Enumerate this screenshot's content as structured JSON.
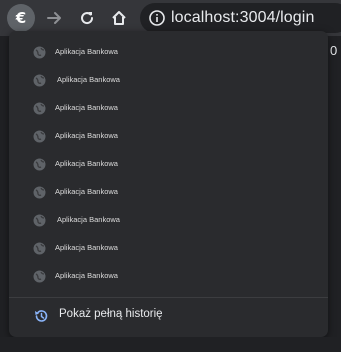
{
  "toolbar": {
    "profile_glyph": "€",
    "icons": [
      "euro-icon",
      "forward-arrow-icon",
      "reload-icon",
      "home-icon",
      "info-icon"
    ],
    "url": "localhost:3004/login",
    "side_text": "0"
  },
  "history_menu": {
    "items": [
      {
        "label": "Aplikacja Bankowa",
        "icon": "globe-icon"
      },
      {
        "label": "Aplikacja Bankowa",
        "icon": "globe-icon"
      },
      {
        "label": "Aplikacja Bankowa",
        "icon": "globe-icon"
      },
      {
        "label": "Aplikacja Bankowa",
        "icon": "globe-icon"
      },
      {
        "label": "Aplikacja Bankowa",
        "icon": "globe-icon"
      },
      {
        "label": "Aplikacja Bankowa",
        "icon": "globe-icon"
      },
      {
        "label": "Aplikacja Bankowa",
        "icon": "globe-icon"
      },
      {
        "label": "Aplikacja Bankowa",
        "icon": "globe-icon"
      },
      {
        "label": "Aplikacja Bankowa",
        "icon": "globe-icon"
      }
    ],
    "show_full_history": "Pokaż pełną historię",
    "show_full_history_icon": "history-icon"
  },
  "colors": {
    "toolbar_bg": "#35363a",
    "menu_bg": "#2a2b2e",
    "text": "#e8eaed",
    "history_icon": "#8ab4f8"
  }
}
